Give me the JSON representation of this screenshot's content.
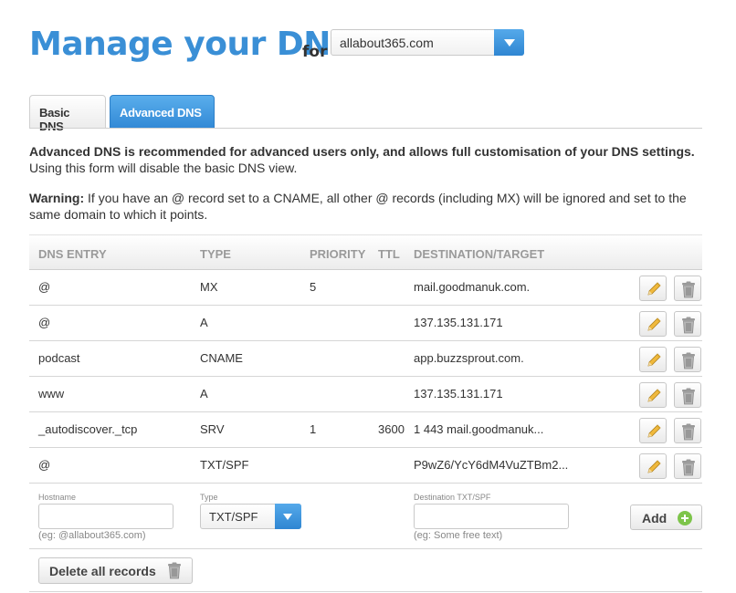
{
  "header": {
    "title": "Manage your DNS",
    "for_label": "for",
    "domain_selected": "allabout365.com"
  },
  "tabs": [
    {
      "label": "Basic DNS",
      "active": false
    },
    {
      "label": "Advanced DNS",
      "active": true
    }
  ],
  "intro": {
    "bold": "Advanced DNS is recommended for advanced users only, and allows full customisation of your DNS settings.",
    "normal": "Using this form will disable the basic DNS view."
  },
  "warning": {
    "label": "Warning:",
    "text": "If you have an @ record set to a CNAME, all other @ records (including MX) will be ignored and set to the same domain to which it points."
  },
  "table": {
    "headers": {
      "entry": "DNS ENTRY",
      "type": "TYPE",
      "priority": "PRIORITY",
      "ttl": "TTL",
      "destination": "DESTINATION/TARGET"
    },
    "rows": [
      {
        "entry": "@",
        "type": "MX",
        "priority": "5",
        "ttl": "",
        "destination": "mail.goodmanuk.com."
      },
      {
        "entry": "@",
        "type": "A",
        "priority": "",
        "ttl": "",
        "destination": "137.135.131.171"
      },
      {
        "entry": "podcast",
        "type": "CNAME",
        "priority": "",
        "ttl": "",
        "destination": "app.buzzsprout.com."
      },
      {
        "entry": "www",
        "type": "A",
        "priority": "",
        "ttl": "",
        "destination": "137.135.131.171"
      },
      {
        "entry": "_autodiscover._tcp",
        "type": "SRV",
        "priority": "1",
        "ttl": "3600",
        "destination": "1 443 mail.goodmanuk..."
      },
      {
        "entry": "@",
        "type": "TXT/SPF",
        "priority": "",
        "ttl": "",
        "destination": "P9wZ6/YcY6dM4VuZTBm2..."
      }
    ]
  },
  "add_form": {
    "hostname_label": "Hostname",
    "hostname_value": "",
    "hostname_hint": "(eg: @allabout365.com)",
    "type_label": "Type",
    "type_value": "TXT/SPF",
    "destination_label": "Destination TXT/SPF",
    "destination_value": "",
    "destination_hint": "(eg: Some free text)",
    "add_label": "Add"
  },
  "delete_all_label": "Delete all records",
  "colors": {
    "accent": "#3a8fd6",
    "add_icon": "#7dc44a"
  }
}
